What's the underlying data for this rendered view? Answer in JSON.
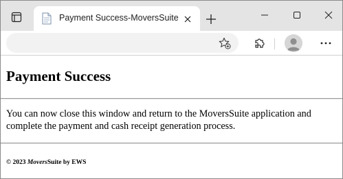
{
  "browser": {
    "tab": {
      "title": "Payment Success-MoversSuite",
      "favicon": "page-icon"
    },
    "icons": {
      "tab_actions": "tab-actions-icon",
      "close_tab": "close-icon",
      "new_tab": "plus-icon",
      "minimize": "minimize-icon",
      "maximize": "maximize-icon",
      "close_window": "close-window-icon",
      "favorites": "star-add-icon",
      "extensions": "puzzle-icon",
      "profile": "profile-avatar",
      "menu": "more-icon"
    },
    "colors": {
      "tabbar_bg": "#e4e4e4",
      "addressbar_bg": "#f2f2f2"
    }
  },
  "page": {
    "title": "Payment Success",
    "message": "You can now close this window and return to the MoversSuite application and complete the payment and cash receipt generation process.",
    "footer": {
      "prefix": "© 2023 ",
      "brand_italic": "Movers",
      "brand_rest": "Suite by EWS"
    }
  }
}
